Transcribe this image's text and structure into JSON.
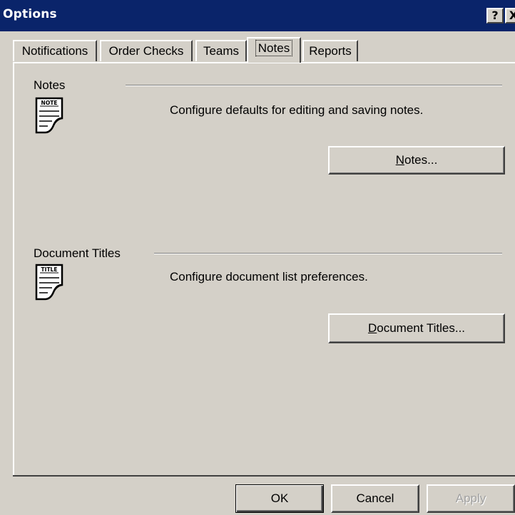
{
  "window": {
    "title": "Options",
    "help_label": "?",
    "close_label": "X"
  },
  "tabs": [
    {
      "label": "Notifications"
    },
    {
      "label": "Order Checks"
    },
    {
      "label": "Teams"
    },
    {
      "label": "Notes",
      "active": true
    },
    {
      "label": "Reports"
    }
  ],
  "notes_group": {
    "label": "Notes",
    "icon_text": "NOTE",
    "description": "Configure defaults for editing and saving notes.",
    "button_mnemonic": "N",
    "button_rest": "otes..."
  },
  "titles_group": {
    "label": "Document Titles",
    "icon_text": "TITLE",
    "description": "Configure document list preferences.",
    "button_mnemonic": "D",
    "button_rest": "ocument Titles..."
  },
  "footer": {
    "ok_label": "OK",
    "cancel_label": "Cancel",
    "apply_label": "Apply"
  }
}
